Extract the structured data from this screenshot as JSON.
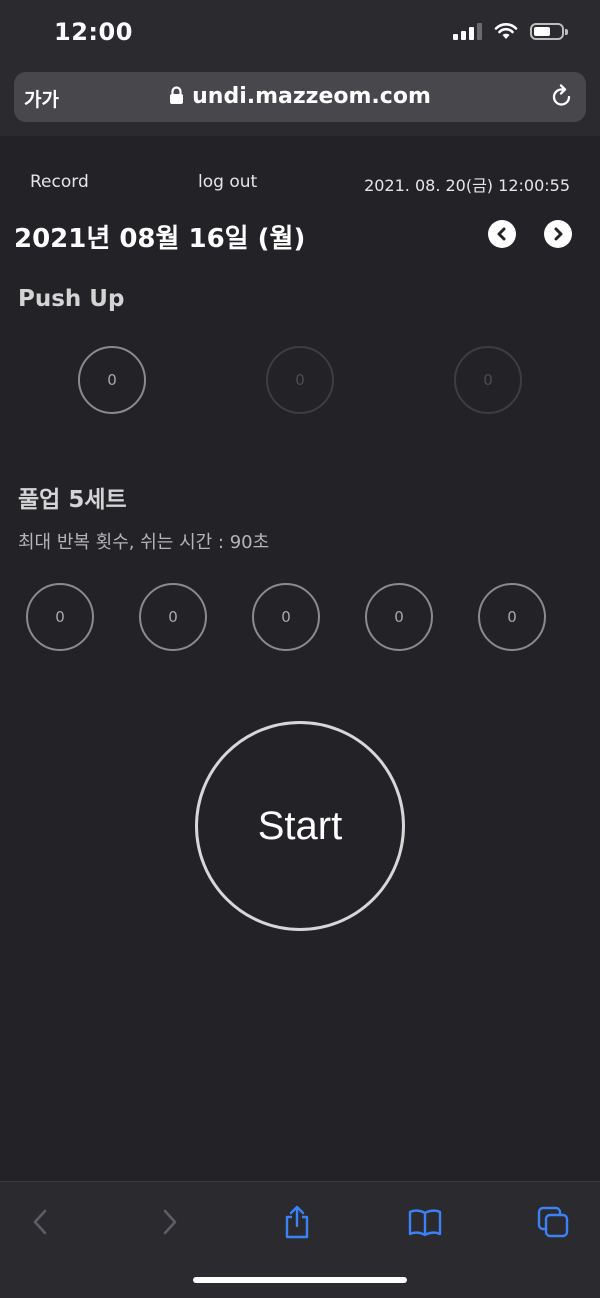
{
  "status_bar": {
    "time": "12:00"
  },
  "browser": {
    "text_size_label": "가가",
    "url": "undi.mazzeom.com"
  },
  "nav": {
    "record_label": "Record",
    "logout_label": "log out",
    "current_datetime": "2021. 08. 20(금) 12:00:55"
  },
  "date_header": {
    "date": "2021년 08월 16일 (월)"
  },
  "sections": [
    {
      "title": "Push Up",
      "sets": [
        "0",
        "0",
        "0"
      ],
      "active_sets": 1
    },
    {
      "title": "풀업 5세트",
      "description": "최대 반복 횟수, 쉬는 시간 : 90초",
      "sets": [
        "0",
        "0",
        "0",
        "0",
        "0"
      ],
      "active_sets": 5
    }
  ],
  "start_label": "Start",
  "colors": {
    "background": "#232227",
    "toolbar_accent": "#3b82f6",
    "toolbar_disabled": "#5e5d63"
  },
  "icons": [
    "lock-icon",
    "reload-icon",
    "prev-day-icon",
    "next-day-icon",
    "back-icon",
    "forward-icon",
    "share-icon",
    "bookmarks-icon",
    "tabs-icon"
  ]
}
